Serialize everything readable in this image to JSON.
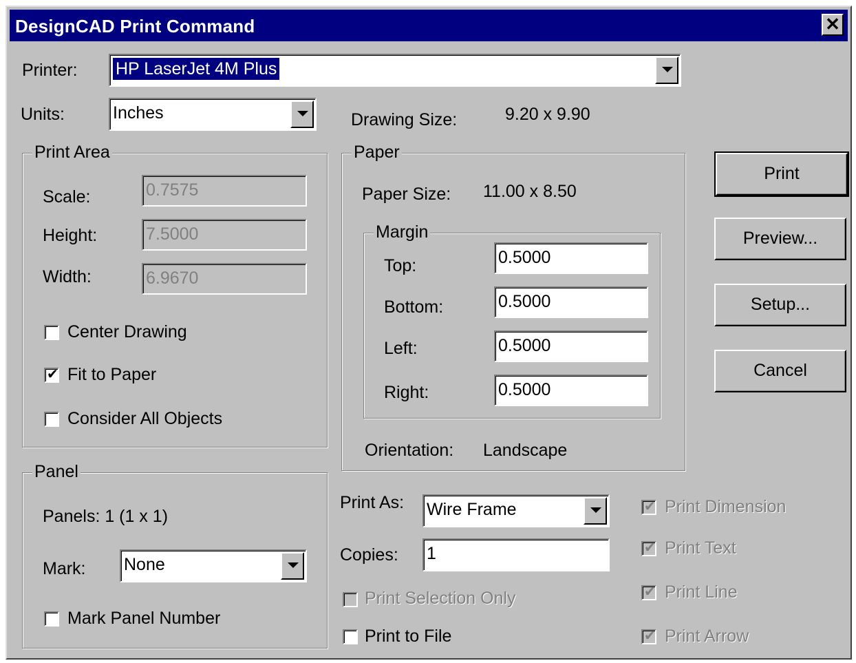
{
  "window": {
    "title": "DesignCAD Print Command",
    "close_label": "✕"
  },
  "printer": {
    "label": "Printer:",
    "value": "HP LaserJet 4M Plus"
  },
  "units": {
    "label": "Units:",
    "value": "Inches"
  },
  "drawing_size": {
    "label": "Drawing Size:",
    "value": "9.20 x 9.90"
  },
  "print_area": {
    "title": "Print Area",
    "scale_label": "Scale:",
    "scale_value": "0.7575",
    "height_label": "Height:",
    "height_value": "7.5000",
    "width_label": "Width:",
    "width_value": "6.9670",
    "center_drawing": {
      "label": "Center Drawing",
      "checked": false
    },
    "fit_to_paper": {
      "label": "Fit to Paper",
      "checked": true
    },
    "consider_all": {
      "label": "Consider All Objects",
      "checked": false
    }
  },
  "paper": {
    "title": "Paper",
    "size_label": "Paper Size:",
    "size_value": "11.00 x 8.50",
    "margin": {
      "title": "Margin",
      "top_label": "Top:",
      "top_value": "0.5000",
      "bottom_label": "Bottom:",
      "bottom_value": "0.5000",
      "left_label": "Left:",
      "left_value": "0.5000",
      "right_label": "Right:",
      "right_value": "0.5000"
    },
    "orientation_label": "Orientation:",
    "orientation_value": "Landscape"
  },
  "panel": {
    "title": "Panel",
    "panels_text": "Panels: 1  (1 x 1)",
    "mark_label": "Mark:",
    "mark_value": "None",
    "mark_panel_number": {
      "label": "Mark Panel Number",
      "checked": false
    }
  },
  "print_as": {
    "label": "Print As:",
    "value": "Wire Frame"
  },
  "copies": {
    "label": "Copies:",
    "value": "1"
  },
  "print_selection_only": {
    "label": "Print Selection Only",
    "checked": false,
    "enabled": false
  },
  "print_to_file": {
    "label": "Print to File",
    "checked": false
  },
  "options": {
    "dimension": {
      "label": "Print Dimension",
      "checked": true
    },
    "text": {
      "label": "Print Text",
      "checked": true
    },
    "line": {
      "label": "Print Line",
      "checked": true
    },
    "arrow": {
      "label": "Print Arrow",
      "checked": true
    }
  },
  "buttons": {
    "print": "Print",
    "preview": "Preview...",
    "setup": "Setup...",
    "cancel": "Cancel"
  },
  "colors": {
    "title_bar": "#000080",
    "face": "#c0c0c0",
    "disabled_text": "#808080"
  }
}
